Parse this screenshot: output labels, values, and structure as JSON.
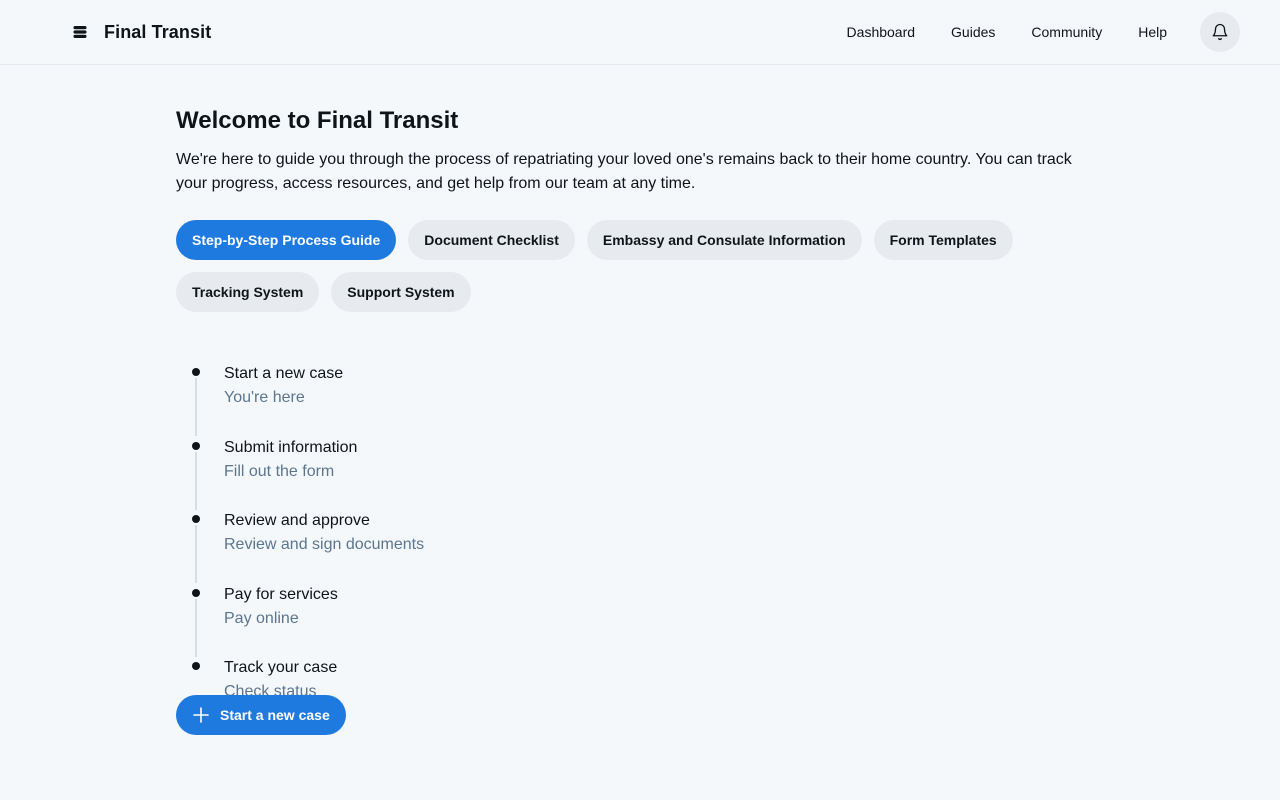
{
  "header": {
    "brand": "Final Transit",
    "nav": [
      "Dashboard",
      "Guides",
      "Community",
      "Help"
    ],
    "bell_icon": "bell-icon"
  },
  "main": {
    "title": "Welcome to Final Transit",
    "intro": "We're here to guide you through the process of repatriating your loved one's remains back to their home country. You can track your progress, access resources, and get help from our team at any time.",
    "tabs": [
      {
        "label": "Step-by-Step Process Guide",
        "active": true
      },
      {
        "label": "Document Checklist",
        "active": false
      },
      {
        "label": "Embassy and Consulate Information",
        "active": false
      },
      {
        "label": "Form Templates",
        "active": false
      },
      {
        "label": "Tracking System",
        "active": false
      },
      {
        "label": "Support System",
        "active": false
      }
    ],
    "steps": [
      {
        "title": "Start a new case",
        "subtitle": "You're here"
      },
      {
        "title": "Submit information",
        "subtitle": "Fill out the form"
      },
      {
        "title": "Review and approve",
        "subtitle": "Review and sign documents"
      },
      {
        "title": "Pay for services",
        "subtitle": "Pay online"
      },
      {
        "title": "Track your case",
        "subtitle": "Check status"
      }
    ],
    "cta_label": "Start a new case",
    "cta_icon": "plus-icon"
  },
  "colors": {
    "accent": "#1f7ae0",
    "background": "#f5f8fb",
    "chip_bg": "#e7ebef",
    "muted_text": "#5b7690"
  }
}
